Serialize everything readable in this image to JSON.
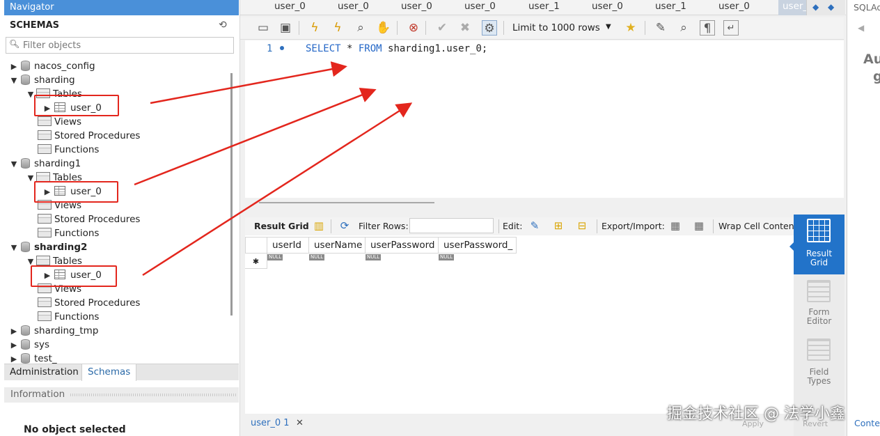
{
  "navigator": {
    "title": "Navigator",
    "schemas_header": "SCHEMAS",
    "filter_placeholder": "Filter objects",
    "tree": {
      "nacos_config": "nacos_config",
      "sharding": "sharding",
      "sharding_tables": "Tables",
      "sharding_table": "user_0",
      "sharding_views": "Views",
      "sharding_procs": "Stored Procedures",
      "sharding_funcs": "Functions",
      "sharding1": "sharding1",
      "sharding1_tables": "Tables",
      "sharding1_table": "user_0",
      "sharding1_views": "Views",
      "sharding1_procs": "Stored Procedures",
      "sharding1_funcs": "Functions",
      "sharding2": "sharding2",
      "sharding2_tables": "Tables",
      "sharding2_table": "user_0",
      "sharding2_views": "Views",
      "sharding2_procs": "Stored Procedures",
      "sharding2_funcs": "Functions",
      "sharding_tmp": "sharding_tmp",
      "sys": "sys",
      "test": "test_"
    },
    "tabs": {
      "admin": "Administration",
      "schemas": "Schemas"
    },
    "info_header": "Information",
    "no_object": "No object selected"
  },
  "editor_tabs": [
    "user_0",
    "user_0",
    "user_0",
    "user_0",
    "user_1",
    "user_0",
    "user_1",
    "user_0",
    "user_"
  ],
  "toolbar": {
    "limit_label": "Limit to 1000 rows"
  },
  "sql": {
    "line_number": "1",
    "kw_select": "SELECT",
    "star": " * ",
    "kw_from": "FROM",
    "rest": " sharding1.user_0;"
  },
  "result_toolbar": {
    "result_grid": "Result Grid",
    "filter_rows": "Filter Rows:",
    "edit": "Edit:",
    "export_import": "Export/Import:",
    "wrap": "Wrap Cell Content:"
  },
  "grid": {
    "columns": [
      "userId",
      "userName",
      "userPassword",
      "userPassword_"
    ],
    "row_marker": "✱",
    "null_text": "NULL"
  },
  "side_panel": {
    "result_grid_l1": "Result",
    "result_grid_l2": "Grid",
    "form_editor_l1": "Form",
    "form_editor_l2": "Editor",
    "field_types_l1": "Field",
    "field_types_l2": "Types"
  },
  "bottom": {
    "result_tab": "user_0 1",
    "close": "✕",
    "apply": "Apply",
    "revert": "Revert"
  },
  "right_panel": {
    "title": "SQLAd",
    "big1": "Au",
    "big2": "g",
    "bottom": "Conte"
  },
  "watermark": "掘金技术社区 @ 法学小鑫",
  "colors": {
    "accent": "#2273c9",
    "highlight": "#e3261d",
    "nav_header": "#4a90d9"
  }
}
